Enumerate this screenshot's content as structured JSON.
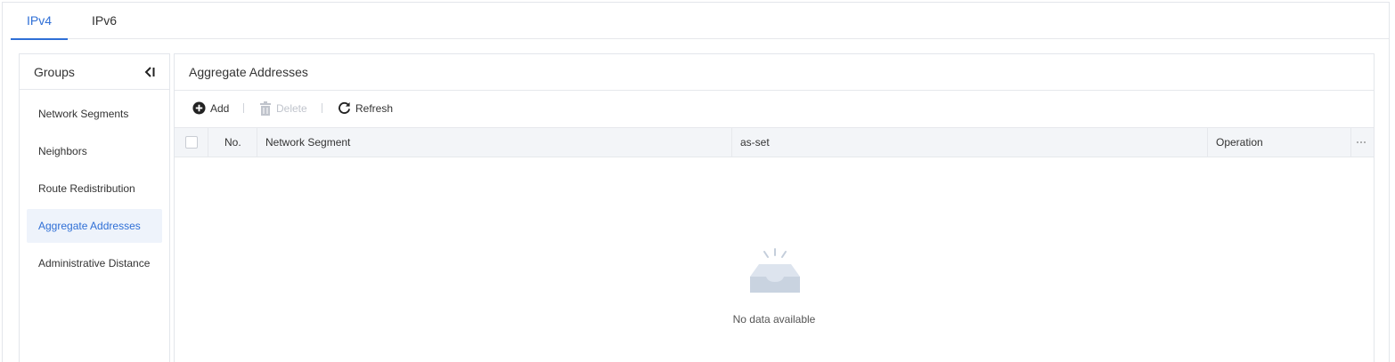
{
  "tabs": [
    {
      "label": "IPv4",
      "active": true
    },
    {
      "label": "IPv6",
      "active": false
    }
  ],
  "sidebar": {
    "title": "Groups",
    "items": [
      {
        "label": "Network Segments",
        "active": false
      },
      {
        "label": "Neighbors",
        "active": false
      },
      {
        "label": "Route Redistribution",
        "active": false
      },
      {
        "label": "Aggregate Addresses",
        "active": true
      },
      {
        "label": "Administrative Distance",
        "active": false
      }
    ]
  },
  "main": {
    "title": "Aggregate Addresses",
    "toolbar": {
      "add_label": "Add",
      "delete_label": "Delete",
      "refresh_label": "Refresh"
    },
    "table": {
      "columns": [
        "No.",
        "Network Segment",
        "as-set",
        "Operation"
      ],
      "rows": []
    },
    "empty_text": "No data available"
  },
  "colors": {
    "accent": "#2f6fd6",
    "header_bg": "#f3f5f8",
    "active_item_bg": "#eef3fb",
    "disabled_text": "#c0c4cc"
  }
}
